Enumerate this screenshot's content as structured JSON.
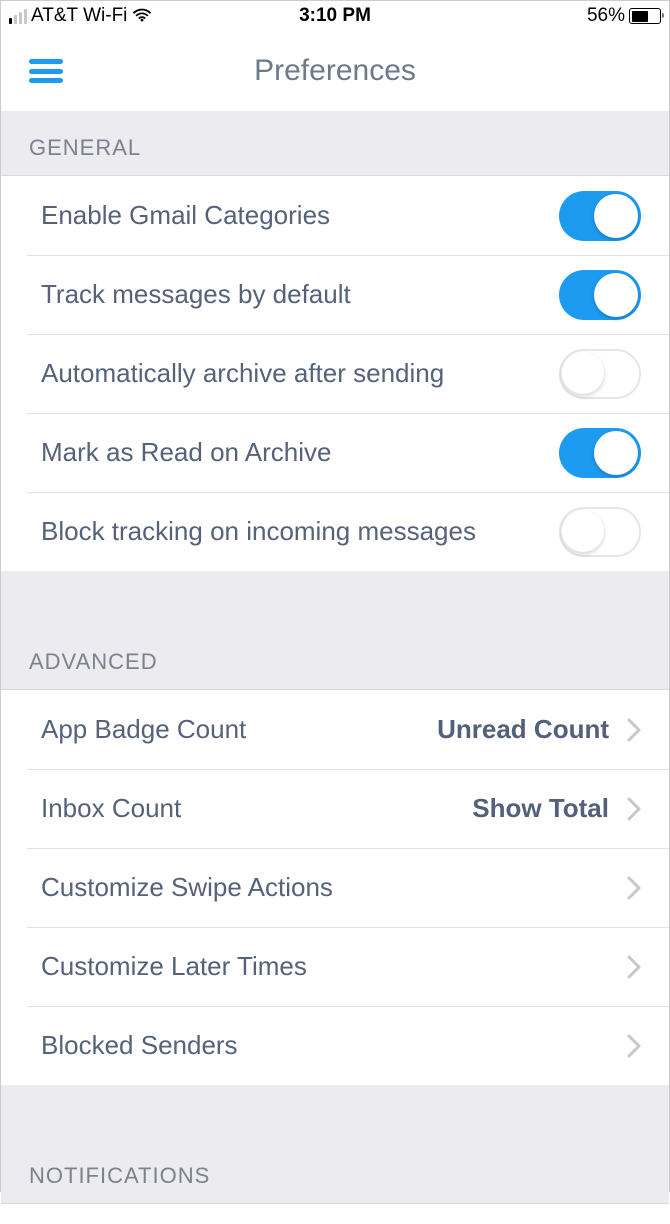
{
  "status": {
    "carrier": "AT&T Wi-Fi",
    "time": "3:10 PM",
    "battery_pct": "56%"
  },
  "header": {
    "title": "Preferences"
  },
  "sections": {
    "general": {
      "title": "GENERAL",
      "items": [
        {
          "label": "Enable Gmail Categories",
          "on": true
        },
        {
          "label": "Track messages by default",
          "on": true
        },
        {
          "label": "Automatically archive after sending",
          "on": false
        },
        {
          "label": "Mark as Read on Archive",
          "on": true
        },
        {
          "label": "Block tracking on incoming messages",
          "on": false
        }
      ]
    },
    "advanced": {
      "title": "ADVANCED",
      "items": [
        {
          "label": "App Badge Count",
          "value": "Unread Count"
        },
        {
          "label": "Inbox Count",
          "value": "Show Total"
        },
        {
          "label": "Customize Swipe Actions",
          "value": ""
        },
        {
          "label": "Customize Later Times",
          "value": ""
        },
        {
          "label": "Blocked Senders",
          "value": ""
        }
      ]
    },
    "notifications": {
      "title": "NOTIFICATIONS"
    }
  }
}
